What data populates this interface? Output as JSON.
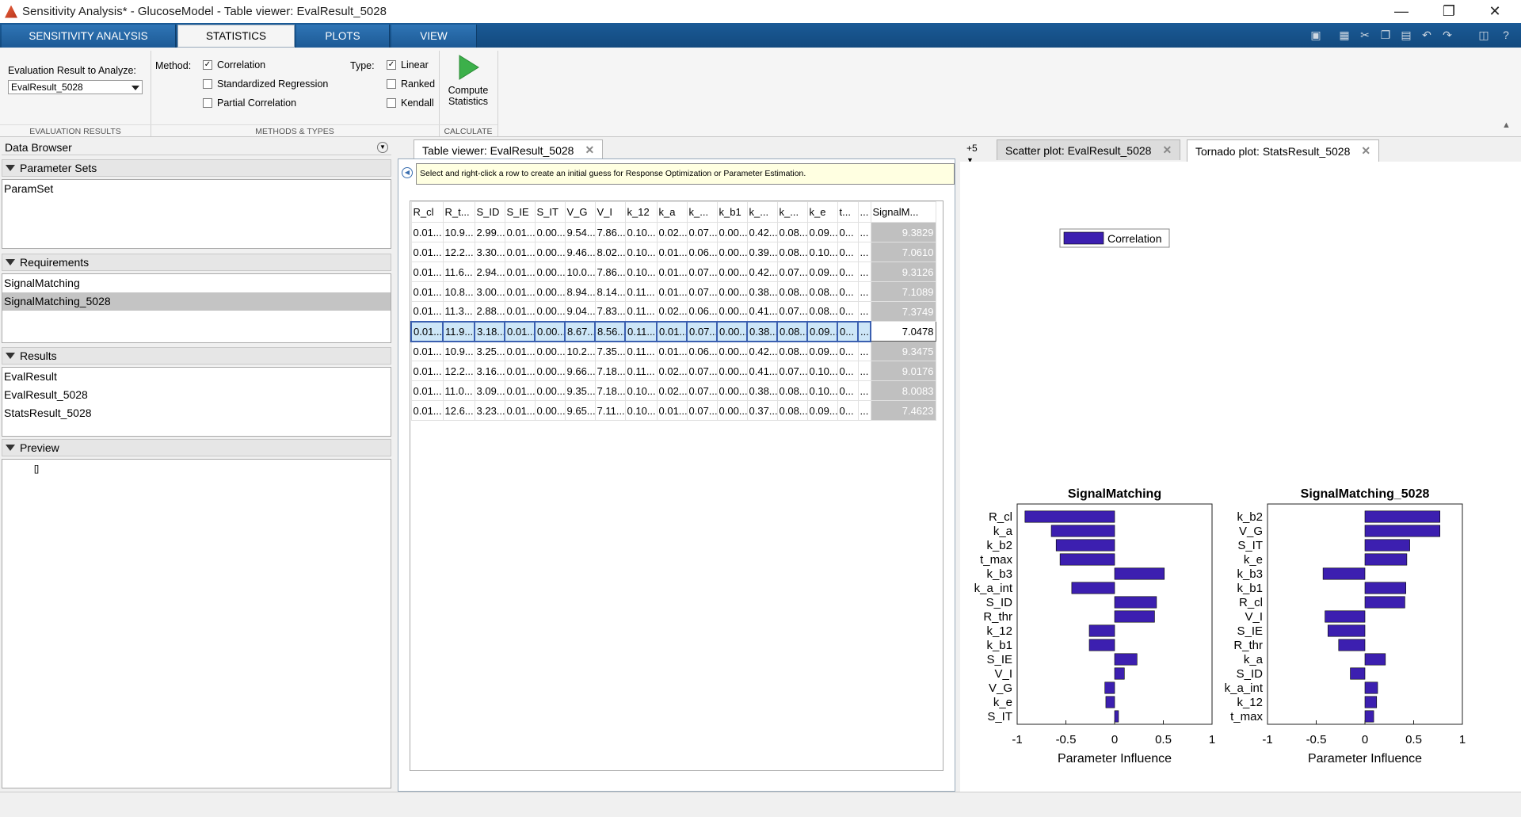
{
  "window": {
    "title": "Sensitivity Analysis* - GlucoseModel - Table viewer:  EvalResult_5028"
  },
  "ribbon": {
    "tabs": [
      "SENSITIVITY ANALYSIS",
      "STATISTICS",
      "PLOTS",
      "VIEW"
    ],
    "eval_label": "Evaluation Result to Analyze:",
    "eval_value": "EvalResult_5028",
    "method_label": "Method:",
    "methods": [
      {
        "label": "Correlation",
        "checked": true
      },
      {
        "label": "Standardized Regression",
        "checked": false
      },
      {
        "label": "Partial Correlation",
        "checked": false
      }
    ],
    "type_label": "Type:",
    "types": [
      {
        "label": "Linear",
        "checked": true
      },
      {
        "label": "Ranked",
        "checked": false
      },
      {
        "label": "Kendall",
        "checked": false
      }
    ],
    "compute_label_1": "Compute",
    "compute_label_2": "Statistics",
    "sections": [
      "EVALUATION RESULTS",
      "METHODS & TYPES",
      "CALCULATE"
    ]
  },
  "data_browser": {
    "title": "Data Browser",
    "parameter_sets": {
      "header": "Parameter Sets",
      "items": [
        "ParamSet"
      ]
    },
    "requirements": {
      "header": "Requirements",
      "items": [
        "SignalMatching",
        "SignalMatching_5028"
      ],
      "selected": 1
    },
    "results": {
      "header": "Results",
      "items": [
        "EvalResult",
        "EvalResult_5028",
        "StatsResult_5028"
      ]
    },
    "preview": {
      "header": "Preview",
      "content": "[]"
    }
  },
  "table_viewer": {
    "tab_label": "Table viewer:  EvalResult_5028",
    "banner": "Select and right-click a row to create an initial guess for Response Optimization or Parameter Estimation.",
    "columns": [
      "R_cl",
      "R_t...",
      "S_ID",
      "S_IE",
      "S_IT",
      "V_G",
      "V_I",
      "k_12",
      "k_a",
      "k_...",
      "k_b1",
      "k_...",
      "k_...",
      "k_e",
      "t...",
      "...",
      "SignalM..."
    ],
    "rows": [
      [
        "0.01...",
        "10.9...",
        "2.99...",
        "0.01...",
        "0.00...",
        "9.54...",
        "7.86...",
        "0.10...",
        "0.02...",
        "0.07...",
        "0.00...",
        "0.42...",
        "0.08...",
        "0.09...",
        "0...",
        "...",
        "9.3829"
      ],
      [
        "0.01...",
        "12.2...",
        "3.30...",
        "0.01...",
        "0.00...",
        "9.46...",
        "8.02...",
        "0.10...",
        "0.01...",
        "0.06...",
        "0.00...",
        "0.39...",
        "0.08...",
        "0.10...",
        "0...",
        "...",
        "7.0610"
      ],
      [
        "0.01...",
        "11.6...",
        "2.94...",
        "0.01...",
        "0.00...",
        "10.0...",
        "7.86...",
        "0.10...",
        "0.01...",
        "0.07...",
        "0.00...",
        "0.42...",
        "0.07...",
        "0.09...",
        "0...",
        "...",
        "9.3126"
      ],
      [
        "0.01...",
        "10.8...",
        "3.00...",
        "0.01...",
        "0.00...",
        "8.94...",
        "8.14...",
        "0.11...",
        "0.01...",
        "0.07...",
        "0.00...",
        "0.38...",
        "0.08...",
        "0.08...",
        "0...",
        "...",
        "7.1089"
      ],
      [
        "0.01...",
        "11.3...",
        "2.88...",
        "0.01...",
        "0.00...",
        "9.04...",
        "7.83...",
        "0.11...",
        "0.02...",
        "0.06...",
        "0.00...",
        "0.41...",
        "0.07...",
        "0.08...",
        "0...",
        "...",
        "7.3749"
      ],
      [
        "0.01...",
        "11.9...",
        "3.18...",
        "0.01...",
        "0.00...",
        "8.67...",
        "8.56...",
        "0.11...",
        "0.01...",
        "0.07...",
        "0.00...",
        "0.38...",
        "0.08...",
        "0.09...",
        "0...",
        "...",
        "7.0478"
      ],
      [
        "0.01...",
        "10.9...",
        "3.25...",
        "0.01...",
        "0.00...",
        "10.2...",
        "7.35...",
        "0.11...",
        "0.01...",
        "0.06...",
        "0.00...",
        "0.42...",
        "0.08...",
        "0.09...",
        "0...",
        "...",
        "9.3475"
      ],
      [
        "0.01...",
        "12.2...",
        "3.16...",
        "0.01...",
        "0.00...",
        "9.66...",
        "7.18...",
        "0.11...",
        "0.02...",
        "0.07...",
        "0.00...",
        "0.41...",
        "0.07...",
        "0.10...",
        "0...",
        "...",
        "9.0176"
      ],
      [
        "0.01...",
        "11.0...",
        "3.09...",
        "0.01...",
        "0.00...",
        "9.35...",
        "7.18...",
        "0.10...",
        "0.02...",
        "0.07...",
        "0.00...",
        "0.38...",
        "0.08...",
        "0.10...",
        "0...",
        "...",
        "8.0083"
      ],
      [
        "0.01...",
        "12.6...",
        "3.23...",
        "0.01...",
        "0.00...",
        "9.65...",
        "7.11...",
        "0.10...",
        "0.01...",
        "0.07...",
        "0.00...",
        "0.37...",
        "0.08...",
        "0.09...",
        "0...",
        "...",
        "7.4623"
      ]
    ],
    "selected_row": 5
  },
  "right_tabs": {
    "overflow": "+5",
    "scatter": "Scatter plot:  EvalResult_5028",
    "tornado": "Tornado plot:  StatsResult_5028"
  },
  "colors": {
    "bar": "#3c1fb0",
    "accent": "#1d5a95"
  },
  "chart_data": [
    {
      "type": "bar",
      "orientation": "horizontal",
      "title": "SignalMatching",
      "xlabel": "Parameter Influence",
      "xlim": [
        -1,
        1
      ],
      "xticks": [
        "-1",
        "-0.5",
        "0",
        "0.5",
        "1"
      ],
      "legend": "Correlation",
      "categories": [
        "R_cl",
        "k_a",
        "k_b2",
        "t_max",
        "k_b3",
        "k_a_int",
        "S_ID",
        "R_thr",
        "k_12",
        "k_b1",
        "S_IE",
        "V_I",
        "V_G",
        "k_e",
        "S_IT"
      ],
      "values": [
        -0.92,
        -0.65,
        -0.6,
        -0.56,
        0.51,
        -0.44,
        0.43,
        0.41,
        -0.26,
        -0.26,
        0.23,
        0.1,
        -0.1,
        -0.09,
        0.04
      ]
    },
    {
      "type": "bar",
      "orientation": "horizontal",
      "title": "SignalMatching_5028",
      "xlabel": "Parameter Influence",
      "xlim": [
        -1,
        1
      ],
      "xticks": [
        "-1",
        "-0.5",
        "0",
        "0.5",
        "1"
      ],
      "categories": [
        "k_b2",
        "V_G",
        "S_IT",
        "k_e",
        "k_b3",
        "k_b1",
        "R_cl",
        "V_I",
        "S_IE",
        "R_thr",
        "k_a",
        "S_ID",
        "k_a_int",
        "k_12",
        "t_max"
      ],
      "values": [
        0.77,
        0.77,
        0.46,
        0.43,
        -0.43,
        0.42,
        0.41,
        -0.41,
        -0.38,
        -0.27,
        0.21,
        -0.15,
        0.13,
        0.12,
        0.09
      ]
    }
  ]
}
